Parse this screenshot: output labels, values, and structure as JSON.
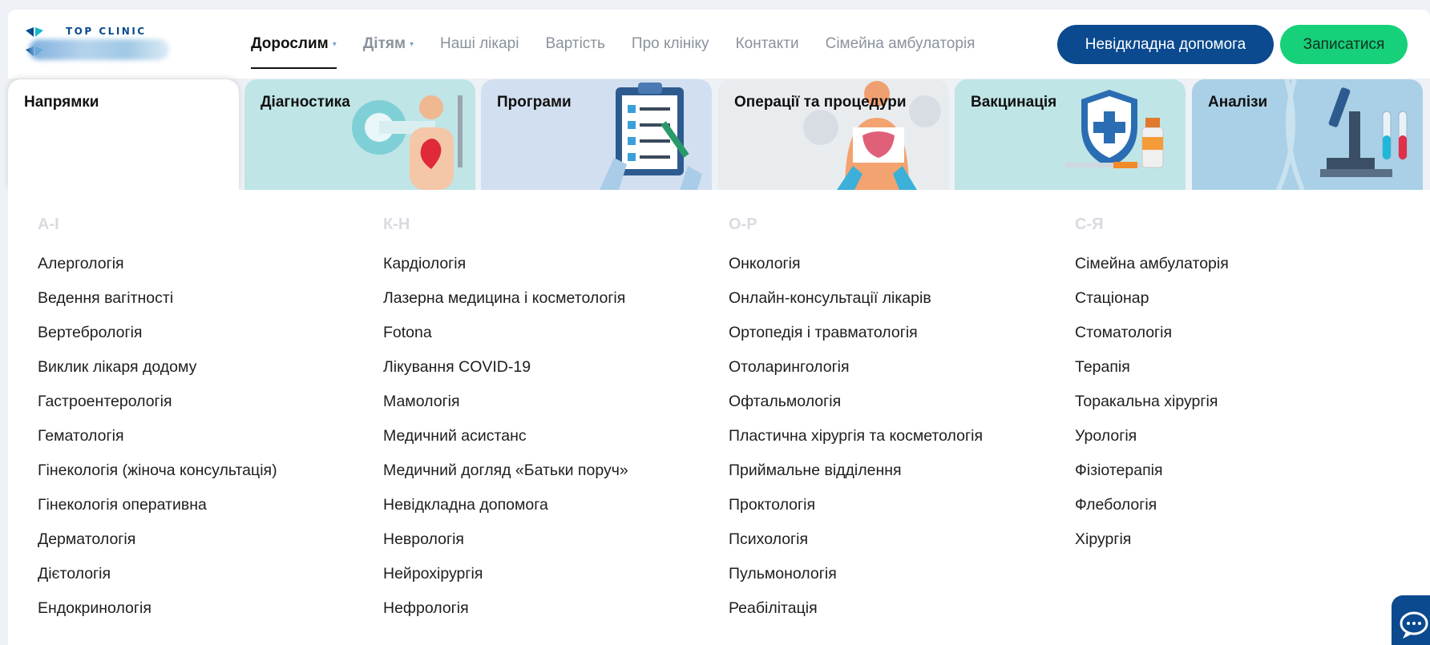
{
  "logo": {
    "text": "TOP CLINIC"
  },
  "nav": {
    "items": [
      {
        "label": "Дорослим",
        "caret": "▾"
      },
      {
        "label": "Дітям",
        "caret": "▾"
      },
      {
        "label": "Наші лікарі"
      },
      {
        "label": "Вартість"
      },
      {
        "label": "Про клініку"
      },
      {
        "label": "Контакти"
      },
      {
        "label": "Сімейна амбулаторія"
      }
    ],
    "urgent_button": "Невідкладна допомога",
    "book_button": "Записатися"
  },
  "tabs": [
    {
      "label": "Напрямки"
    },
    {
      "label": "Діагностика"
    },
    {
      "label": "Програми"
    },
    {
      "label": "Операції та процедури"
    },
    {
      "label": "Вакцинація"
    },
    {
      "label": "Аналізи"
    }
  ],
  "columns": [
    {
      "header": "А-І",
      "items": [
        "Алергологія",
        "Ведення вагітності",
        "Вертебрологія",
        "Виклик лікаря додому",
        "Гастроентерологія",
        "Гематологія",
        "Гінекологія (жіноча консультація)",
        "Гінекологія оперативна",
        "Дерматологія",
        "Дієтологія",
        "Ендокринологія"
      ]
    },
    {
      "header": "К-Н",
      "items": [
        "Кардіологія",
        "Лазерна медицина і косметологія",
        "Fotona",
        "Лікування COVID-19",
        "Мамологія",
        "Медичний асистанс",
        "Медичний догляд «Батьки поруч»",
        "Невідкладна допомога",
        "Неврологія",
        "Нейрохірургія",
        "Нефрологія"
      ]
    },
    {
      "header": "О-Р",
      "items": [
        "Онкологія",
        "Онлайн-консультації лікарів",
        "Ортопедія і травматологія",
        "Отоларингологія",
        "Офтальмологія",
        "Пластична хірургія та косметологія",
        "Приймальне відділення",
        "Проктологія",
        "Психологія",
        "Пульмонологія",
        "Реабілітація"
      ]
    },
    {
      "header": "С-Я",
      "items": [
        "Сімейна амбулаторія",
        "Стаціонар",
        "Стоматологія",
        "Терапія",
        "Торакальна хірургія",
        "Урологія",
        "Фізіотерапія",
        "Флебологія",
        "Хірургія"
      ]
    }
  ],
  "icons": {
    "chat": "chat-bubbles-icon",
    "logo": "clinic-logo-icon"
  },
  "colors": {
    "brand_blue": "#0b4a8e",
    "accent_green": "#16d17a",
    "header_gray": "#d8dbe0"
  }
}
